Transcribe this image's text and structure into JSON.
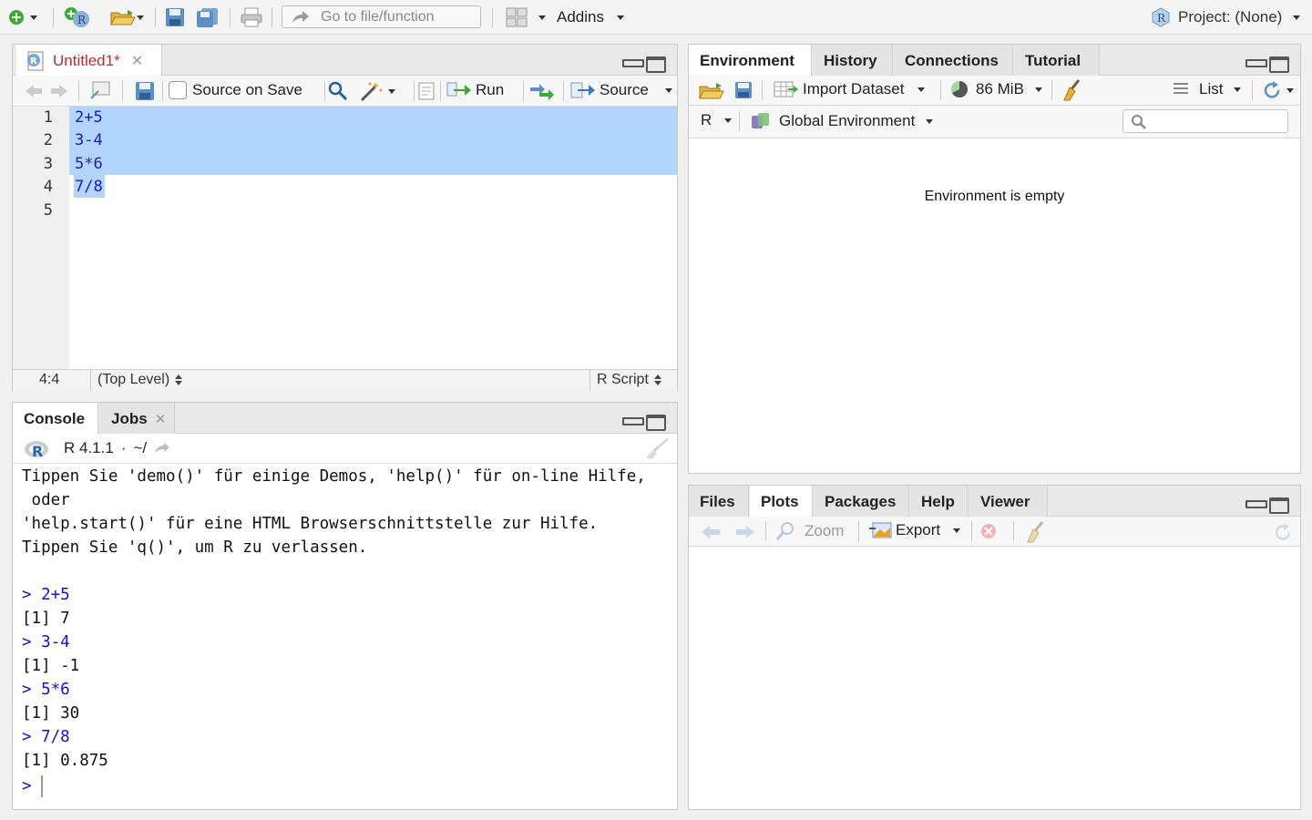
{
  "topbar": {
    "goto_placeholder": "Go to file/function",
    "addins_label": "Addins",
    "project_label": "Project: (None)"
  },
  "editor": {
    "tab_title": "Untitled1*",
    "source_on_save_label": "Source on Save",
    "run_label": "Run",
    "source_label": "Source",
    "line_numbers": [
      "1",
      "2",
      "3",
      "4",
      "5"
    ],
    "lines": [
      "2+5",
      "3-4",
      "5*6",
      "7/8",
      ""
    ],
    "cursor_position": "4:4",
    "scope": "(Top Level)",
    "file_type": "R Script"
  },
  "console": {
    "tabs": [
      "Console",
      "Jobs"
    ],
    "r_version": "R 4.1.1",
    "working_dir": "~/",
    "lines": [
      {
        "text": "Tippen Sie 'demo()' für einige Demos, 'help()' für on-line Hilfe,",
        "kind": "out"
      },
      {
        "text": " oder",
        "kind": "out"
      },
      {
        "text": "'help.start()' für eine HTML Browserschnittstelle zur Hilfe.",
        "kind": "out"
      },
      {
        "text": "Tippen Sie 'q()', um R zu verlassen.",
        "kind": "out"
      },
      {
        "text": "",
        "kind": "out"
      },
      {
        "text": "> 2+5",
        "kind": "cmd"
      },
      {
        "text": "[1] 7",
        "kind": "out"
      },
      {
        "text": "> 3-4",
        "kind": "cmd"
      },
      {
        "text": "[1] -1",
        "kind": "out"
      },
      {
        "text": "> 5*6",
        "kind": "cmd"
      },
      {
        "text": "[1] 30",
        "kind": "out"
      },
      {
        "text": "> 7/8",
        "kind": "cmd"
      },
      {
        "text": "[1] 0.875",
        "kind": "out"
      }
    ],
    "prompt": ">"
  },
  "environment": {
    "tabs": [
      "Environment",
      "History",
      "Connections",
      "Tutorial"
    ],
    "import_label": "Import Dataset",
    "memory_label": "86 MiB",
    "view_label": "List",
    "language": "R",
    "scope_label": "Global Environment",
    "empty_message": "Environment is empty"
  },
  "files": {
    "tabs": [
      "Files",
      "Plots",
      "Packages",
      "Help",
      "Viewer"
    ],
    "zoom_label": "Zoom",
    "export_label": "Export"
  },
  "colors": {
    "selection": "#b3d4fd",
    "command_text": "#1212c8",
    "accent_green": "#3aaa35",
    "close_red": "#e04848"
  }
}
